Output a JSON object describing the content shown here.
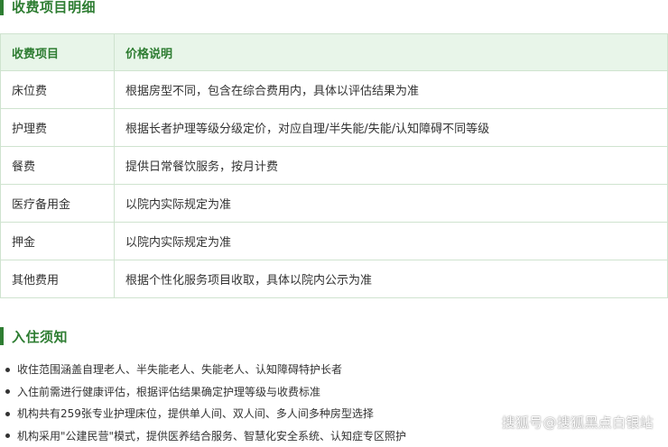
{
  "fee_section": {
    "title": "收费项目明细",
    "table": {
      "headers": [
        "收费项目",
        "价格说明"
      ],
      "rows": [
        [
          "床位费",
          "根据房型不同，包含在综合费用内，具体以评估结果为准"
        ],
        [
          "护理费",
          "根据长者护理等级分级定价，对应自理/半失能/失能/认知障碍不同等级"
        ],
        [
          "餐费",
          "提供日常餐饮服务，按月计费"
        ],
        [
          "医疗备用金",
          "以院内实际规定为准"
        ],
        [
          "押金",
          "以院内实际规定为准"
        ],
        [
          "其他费用",
          "根据个性化服务项目收取，具体以院内公示为准"
        ]
      ]
    }
  },
  "notice_section": {
    "title": "入住须知",
    "items": [
      "收住范围涵盖自理老人、半失能老人、失能老人、认知障碍特护长者",
      "入住前需进行健康评估，根据评估结果确定护理等级与收费标准",
      "机构共有259张专业护理床位，提供单人间、双人间、多人间多种房型选择",
      "机构采用\"公建民营\"模式，提供医养结合服务、智慧化安全系统、认知症专区照护"
    ]
  },
  "watermark": "搜狐号@搜狐黑点白银站",
  "colors": {
    "accent": "#2e7d32",
    "header_bg": "#e8f5e9",
    "border": "#cfe3cf"
  }
}
